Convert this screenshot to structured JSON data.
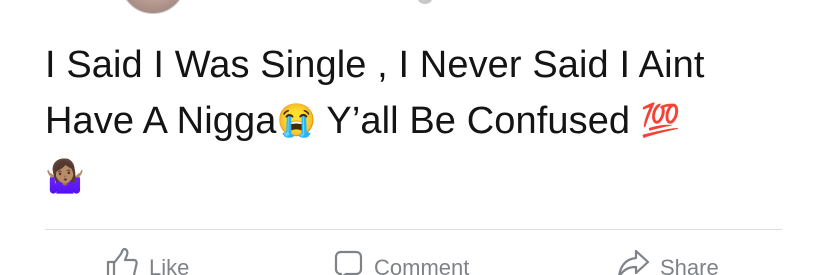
{
  "post": {
    "line1": "I Said I Was Single , I Never Said I Aint",
    "line2_text": "Have A Nigga",
    "line2_emoji": "😭",
    "line2_rest": " Y’all Be Confused ",
    "line2_end_emoji": "💯",
    "line3_emoji": "🤷🏽‍♀️"
  },
  "actions": {
    "like_label": "Like",
    "comment_label": "Comment",
    "share_label": "Share"
  },
  "icons": {
    "like": "thumbs-up-icon",
    "comment": "comment-icon",
    "share": "share-icon"
  },
  "colors": {
    "text": "#141414",
    "action": "#7f8388",
    "divider": "#dddddd"
  }
}
